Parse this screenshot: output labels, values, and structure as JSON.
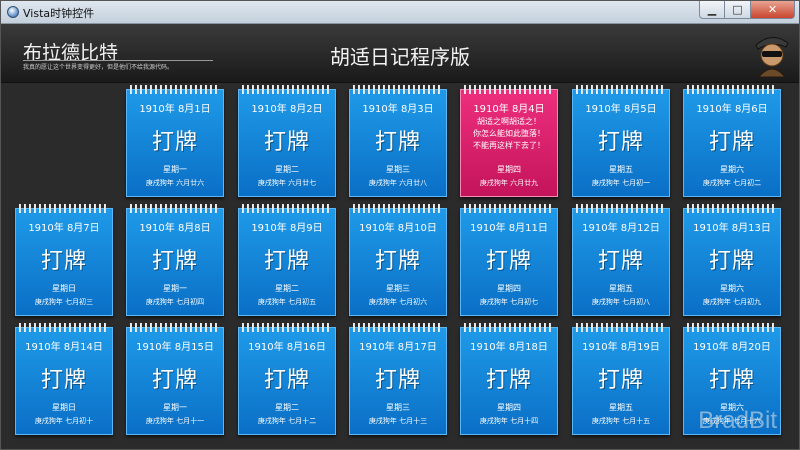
{
  "window": {
    "title": "Vista时钟控件"
  },
  "header": {
    "brand_name": "布拉德比特",
    "brand_motto": "我真的愿让这个世界变得更好，但是他们不给我源代码。",
    "app_heading": "胡适日记程序版"
  },
  "watermark": "BradBit",
  "cards": [
    {
      "date": "1910年  8月1日",
      "word": "打牌",
      "weekday": "星期一",
      "lunar": "庚戌狗年  六月廿六"
    },
    {
      "date": "1910年  8月2日",
      "word": "打牌",
      "weekday": "星期二",
      "lunar": "庚戌狗年  六月廿七"
    },
    {
      "date": "1910年  8月3日",
      "word": "打牌",
      "weekday": "星期三",
      "lunar": "庚戌狗年  六月廿八"
    },
    {
      "date": "1910年  8月4日",
      "note_lines": [
        "胡适之啊胡适之！",
        "你怎么能如此堕落！",
        "不能再这样下去了！"
      ],
      "weekday": "星期四",
      "lunar": "庚戌狗年  六月廿九",
      "highlight": true
    },
    {
      "date": "1910年  8月5日",
      "word": "打牌",
      "weekday": "星期五",
      "lunar": "庚戌狗年  七月初一"
    },
    {
      "date": "1910年  8月6日",
      "word": "打牌",
      "weekday": "星期六",
      "lunar": "庚戌狗年  七月初二"
    },
    {
      "date": "1910年  8月7日",
      "word": "打牌",
      "weekday": "星期日",
      "lunar": "庚戌狗年  七月初三"
    },
    {
      "date": "1910年  8月8日",
      "word": "打牌",
      "weekday": "星期一",
      "lunar": "庚戌狗年  七月初四"
    },
    {
      "date": "1910年  8月9日",
      "word": "打牌",
      "weekday": "星期二",
      "lunar": "庚戌狗年  七月初五"
    },
    {
      "date": "1910年  8月10日",
      "word": "打牌",
      "weekday": "星期三",
      "lunar": "庚戌狗年  七月初六"
    },
    {
      "date": "1910年  8月11日",
      "word": "打牌",
      "weekday": "星期四",
      "lunar": "庚戌狗年  七月初七"
    },
    {
      "date": "1910年  8月12日",
      "word": "打牌",
      "weekday": "星期五",
      "lunar": "庚戌狗年  七月初八"
    },
    {
      "date": "1910年  8月13日",
      "word": "打牌",
      "weekday": "星期六",
      "lunar": "庚戌狗年  七月初九"
    },
    {
      "date": "1910年  8月14日",
      "word": "打牌",
      "weekday": "星期日",
      "lunar": "庚戌狗年  七月初十"
    },
    {
      "date": "1910年  8月15日",
      "word": "打牌",
      "weekday": "星期一",
      "lunar": "庚戌狗年  七月十一"
    },
    {
      "date": "1910年  8月16日",
      "word": "打牌",
      "weekday": "星期二",
      "lunar": "庚戌狗年  七月十二"
    },
    {
      "date": "1910年  8月17日",
      "word": "打牌",
      "weekday": "星期三",
      "lunar": "庚戌狗年  七月十三"
    },
    {
      "date": "1910年  8月18日",
      "word": "打牌",
      "weekday": "星期四",
      "lunar": "庚戌狗年  七月十四"
    },
    {
      "date": "1910年  8月19日",
      "word": "打牌",
      "weekday": "星期五",
      "lunar": "庚戌狗年  七月十五"
    },
    {
      "date": "1910年  8月20日",
      "word": "打牌",
      "weekday": "星期六",
      "lunar": "庚戌狗年  七月十六"
    }
  ]
}
